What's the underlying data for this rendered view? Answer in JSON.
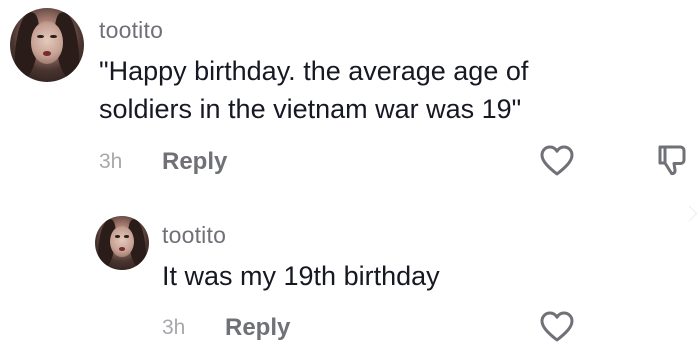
{
  "comments": [
    {
      "username": "tootito",
      "text_line1": "\"Happy birthday. the average age of",
      "text_line2": "soldiers in the vietnam war was 19\"",
      "time": "3h",
      "reply_label": "Reply",
      "icons": [
        "heart-icon",
        "dislike-icon"
      ]
    },
    {
      "username": "tootito",
      "text": "It was my 19th birthday",
      "time": "3h",
      "reply_label": "Reply",
      "icons": [
        "heart-icon"
      ]
    }
  ],
  "colors": {
    "text": "#161823",
    "username": "#6f7177",
    "timestamp": "#a7a8ab",
    "icon": "#6f7177"
  }
}
